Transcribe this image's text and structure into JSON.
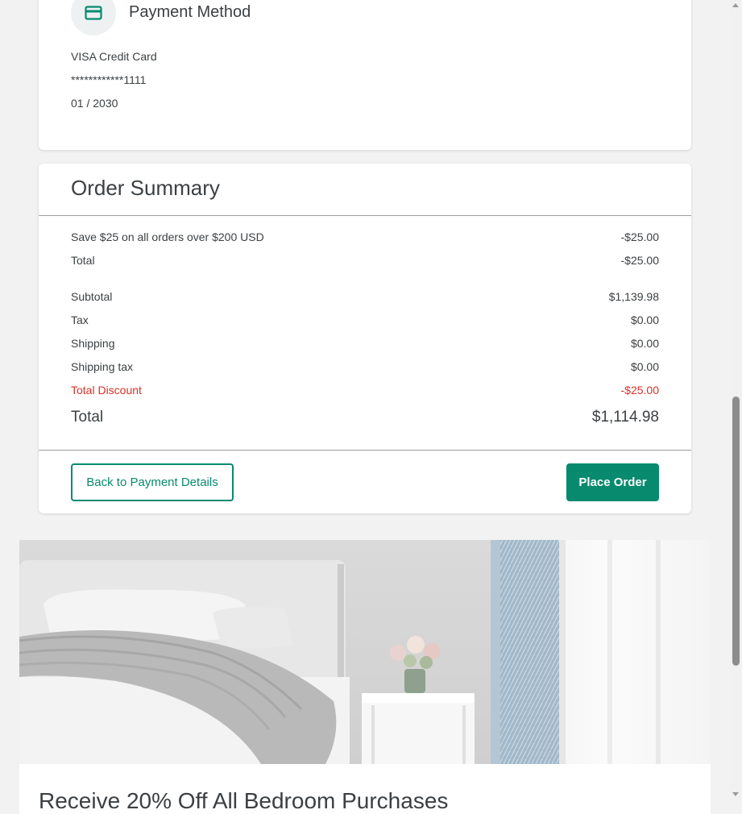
{
  "payment": {
    "title": "Payment Method",
    "icon": "credit-card-icon",
    "card_type": "VISA Credit Card",
    "card_number": "************1111",
    "expiry": "01 / 2030"
  },
  "summary": {
    "title": "Order Summary",
    "promo_rows": [
      {
        "label": "Save $25 on all orders over $200 USD",
        "value": "-$25.00"
      },
      {
        "label": "Total",
        "value": "-$25.00"
      }
    ],
    "rows": [
      {
        "label": "Subtotal",
        "value": "$1,139.98"
      },
      {
        "label": "Tax",
        "value": "$0.00"
      },
      {
        "label": "Shipping",
        "value": "$0.00"
      },
      {
        "label": "Shipping tax",
        "value": "$0.00"
      }
    ],
    "discount": {
      "label": "Total Discount",
      "value": "-$25.00"
    },
    "grand_total": {
      "label": "Total",
      "value": "$1,114.98"
    },
    "back_button": "Back to Payment Details",
    "place_button": "Place Order"
  },
  "promo": {
    "title": "Receive 20% Off All Bedroom Purchases"
  },
  "colors": {
    "accent": "#078a6d",
    "discount": "#d93025",
    "background": "#f2f2f2"
  }
}
